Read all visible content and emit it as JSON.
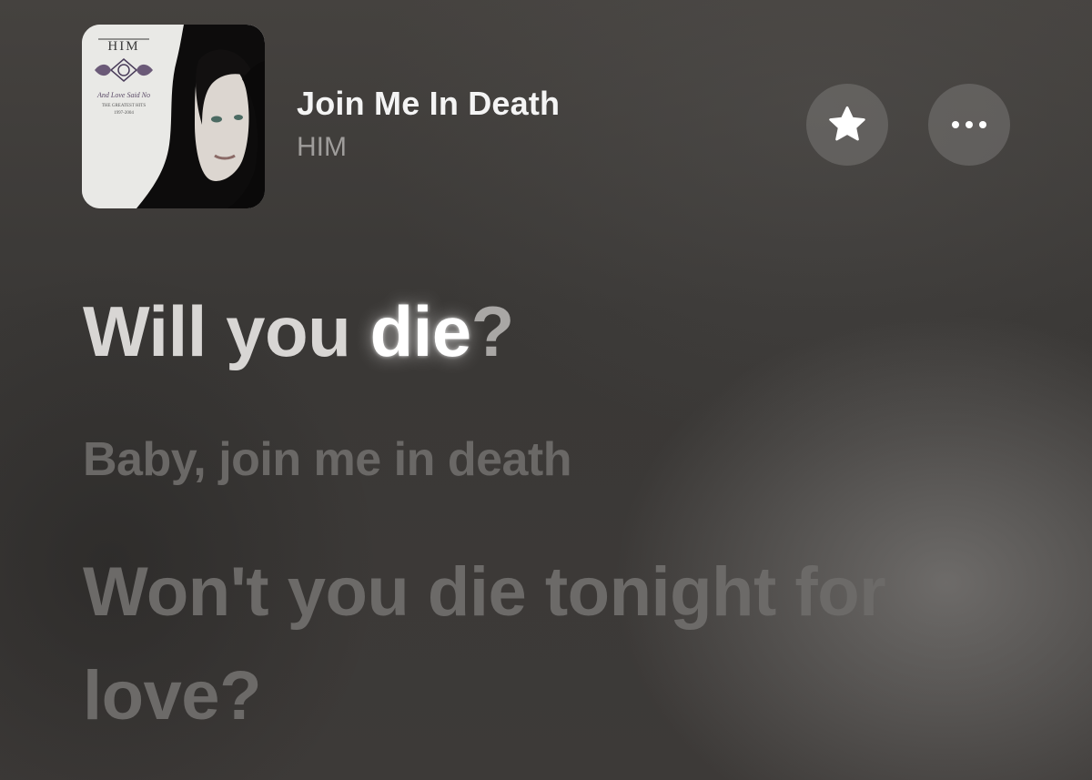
{
  "now_playing": {
    "title": "Join Me In Death",
    "artist": "HIM",
    "artwork": {
      "band_logo": "HIM",
      "album_title": "And Love Said No",
      "subtitle": "THE GREATEST HITS",
      "years": "1997-2004"
    }
  },
  "controls": {
    "favorite_icon": "star-icon",
    "more_icon": "ellipsis-icon"
  },
  "lyrics": {
    "current_line_parts": [
      "Will you ",
      "die",
      "?"
    ],
    "next_line": "Baby, join me in death",
    "after_line": "Won't you die tonight for love?"
  },
  "colors": {
    "accent_text": "#ffffff",
    "dim_text": "#6c6a68",
    "artist_text": "#9f9d9b"
  }
}
